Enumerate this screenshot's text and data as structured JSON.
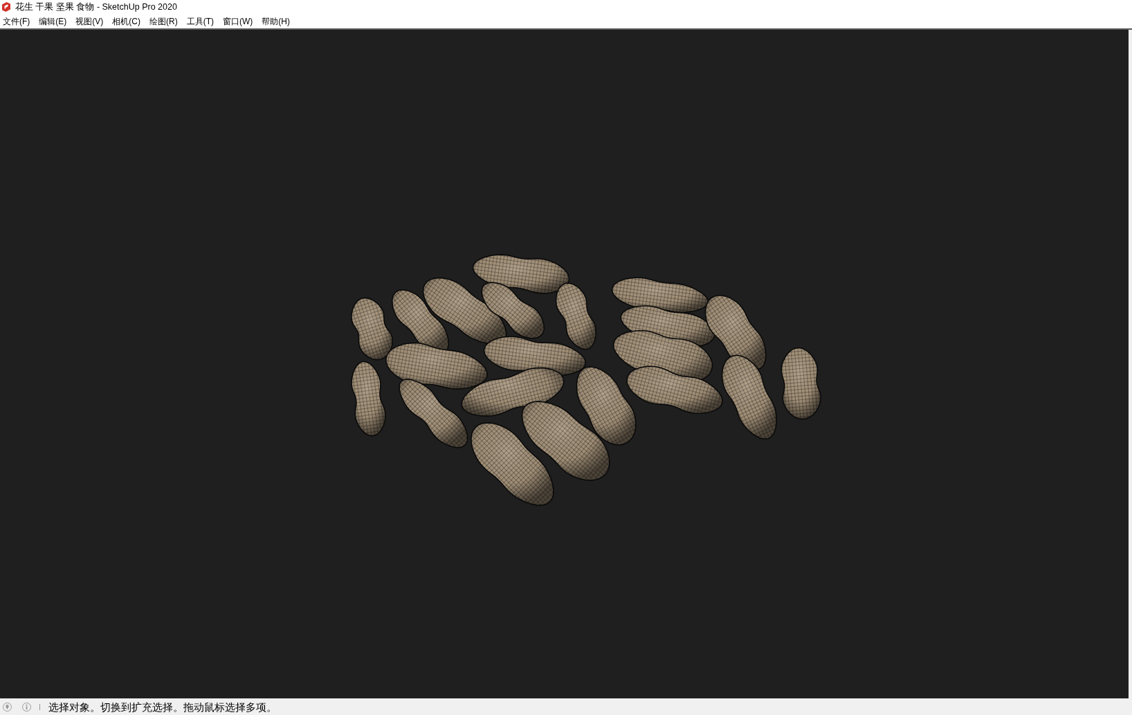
{
  "window": {
    "title": "花生 干果 坚果 食物 - SketchUp Pro 2020"
  },
  "menu_bar": [
    "文件(F)",
    "编辑(E)",
    "视图(V)",
    "相机(C)",
    "绘图(R)",
    "工具(T)",
    "窗口(W)",
    "帮助(H)"
  ],
  "status_bar": {
    "message": "选择对象。切换到扩充选择。拖动鼠标选择多项。"
  }
}
